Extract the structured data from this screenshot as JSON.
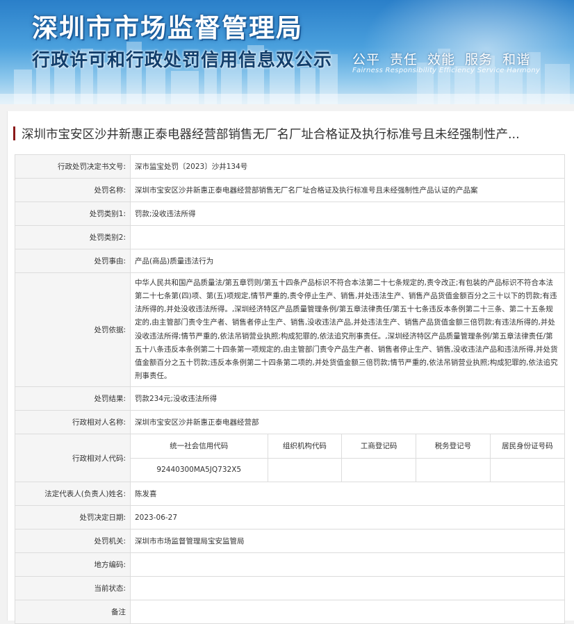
{
  "banner": {
    "title": "深圳市市场监督管理局",
    "subtitle": "行政许可和行政处罚信用信息双公示",
    "slogan_cn": [
      "公平",
      "责任",
      "效能",
      "服务",
      "和谐"
    ],
    "slogan_en": "Fairness  Responsibility  Efficiency  Service  Harmony"
  },
  "page_title": "深圳市宝安区沙井新惠正泰电器经营部销售无厂名厂址合格证及执行标准号且未经强制性产...",
  "rows": {
    "doc_no": {
      "label": "行政处罚决定书文号:",
      "value": "深市监宝处罚〔2023〕沙井134号"
    },
    "case_name": {
      "label": "处罚名称:",
      "value": "深圳市宝安区沙井新惠正泰电器经营部销售无厂名厂址合格证及执行标准号且未经强制性产品认证的产品案"
    },
    "category1": {
      "label": "处罚类别1:",
      "value": "罚款;没收违法所得"
    },
    "category2": {
      "label": "处罚类别2:",
      "value": ""
    },
    "reason": {
      "label": "处罚事由:",
      "value": "产品(商品)质量违法行为"
    },
    "basis": {
      "label": "处罚依据:",
      "value": "中华人民共和国产品质量法/第五章罚则/第五十四条产品标识不符合本法第二十七条规定的,责令改正;有包装的产品标识不符合本法第二十七条第(四)项、第(五)项规定,情节严重的,责令停止生产、销售,并处违法生产、销售产品货值金额百分之三十以下的罚款;有违法所得的,并处没收违法所得。,深圳经济特区产品质量管理条例/第五章法律责任/第五十七条违反本条例第二十三条、第二十五条规定的,由主管部门责令生产者、销售者停止生产、销售,没收违法产品,并处违法生产、销售产品货值金额三倍罚款;有违法所得的,并处没收违法所得;情节严重的,依法吊销营业执照;构成犯罪的,依法追究刑事责任。,深圳经济特区产品质量管理条例/第五章法律责任/第五十八条违反本条例第二十四条第一项规定的,由主管部门责令产品生产者、销售者停止生产、销售,没收违法产品和违法所得,并处货值金额百分之五十罚款;违反本条例第二十四条第二项的,并处货值金额三倍罚款;情节严重的,依法吊销营业执照;构成犯罪的,依法追究刑事责任。"
    },
    "result": {
      "label": "处罚结果:",
      "value": "罚款234元;没收违法所得"
    },
    "party_name": {
      "label": "行政相对人名称:",
      "value": "深圳市宝安区沙井新惠正泰电器经营部"
    },
    "party_code": {
      "label": "行政相对人代码:",
      "headers": [
        "统一社会信用代码",
        "组织机构代码",
        "工商登记码",
        "税务登记号",
        "居民身份证号码"
      ],
      "values": [
        "92440300MA5JQ732X5",
        "",
        "",
        "",
        ""
      ]
    },
    "legal_rep": {
      "label": "法定代表人(负责人)姓名:",
      "value": "陈发喜"
    },
    "decision_date": {
      "label": "处罚决定日期:",
      "value": "2023-06-27"
    },
    "authority": {
      "label": "处罚机关:",
      "value": "深圳市市场监督管理局宝安监管局"
    },
    "local_code": {
      "label": "地方编码:",
      "value": ""
    },
    "status": {
      "label": "当前状态:",
      "value": ""
    },
    "remark": {
      "label": "备注",
      "value": ""
    }
  }
}
